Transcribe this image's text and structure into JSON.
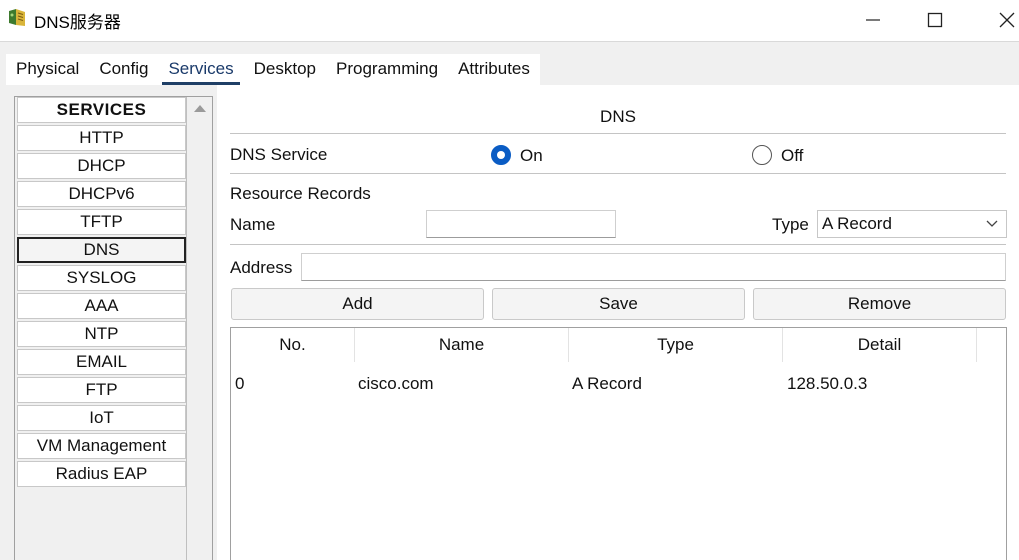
{
  "window": {
    "title": "DNS服务器",
    "icon": "packet-tracer-server-icon",
    "controls": [
      "minimize",
      "maximize",
      "close"
    ]
  },
  "tabs": [
    {
      "label": "Physical",
      "active": false
    },
    {
      "label": "Config",
      "active": false
    },
    {
      "label": "Services",
      "active": true
    },
    {
      "label": "Desktop",
      "active": false
    },
    {
      "label": "Programming",
      "active": false
    },
    {
      "label": "Attributes",
      "active": false
    }
  ],
  "services": {
    "header": "SERVICES",
    "items": [
      "HTTP",
      "DHCP",
      "DHCPv6",
      "TFTP",
      "DNS",
      "SYSLOG",
      "AAA",
      "NTP",
      "EMAIL",
      "FTP",
      "IoT",
      "VM Management",
      "Radius EAP"
    ],
    "selected": "DNS"
  },
  "dns": {
    "title": "DNS",
    "service_label": "DNS Service",
    "on_label": "On",
    "off_label": "Off",
    "service_state": "On",
    "resource_records_label": "Resource Records",
    "name_label": "Name",
    "name_value": "",
    "type_label": "Type",
    "type_value": "A Record",
    "address_label": "Address",
    "address_value": "",
    "add_label": "Add",
    "save_label": "Save",
    "remove_label": "Remove",
    "table": {
      "headers": [
        "No.",
        "Name",
        "Type",
        "Detail"
      ],
      "rows": [
        [
          "0",
          "cisco.com",
          "A Record",
          "128.50.0.3"
        ]
      ]
    }
  },
  "colors": {
    "accent": "#0a5cc4",
    "active_tab_underline": "#1f3f66",
    "panel_bg": "#f0f0f0"
  }
}
